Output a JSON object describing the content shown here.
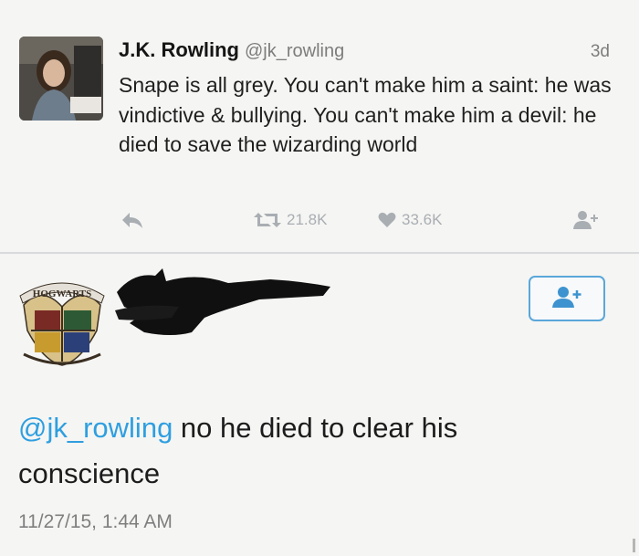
{
  "tweet": {
    "author_name": "J.K. Rowling",
    "author_handle": "@jk_rowling",
    "time_ago": "3d",
    "text": "Snape is all grey. You can't make him a saint: he was vindictive & bullying. You can't make him a devil: he died to save the wizarding world",
    "retweet_count": "21.8K",
    "like_count": "33.6K"
  },
  "reply": {
    "mention": "@jk_rowling",
    "text": " no he died to clear his conscience",
    "timestamp": "11/27/15, 1:44 AM",
    "crest_banner": "HOGWARTS"
  },
  "icons": {
    "reply": "reply-arrow-icon",
    "retweet": "retweet-icon",
    "like": "heart-icon",
    "follow": "add-user-icon"
  },
  "colors": {
    "link": "#2e9fe0",
    "action_gray": "#a9aeb3",
    "follow_border": "#5aa7d9"
  }
}
